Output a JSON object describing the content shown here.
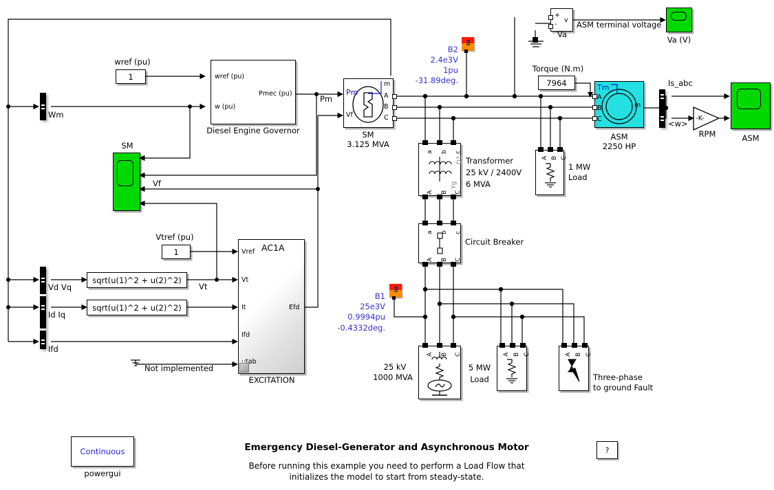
{
  "model": {
    "title": "Emergency Diesel-Generator and Asynchronous Motor",
    "subtitle_line1": "Before running this example you need to perform a Load Flow that",
    "subtitle_line2": "initializes the model to start from steady-state.",
    "help_label": "?"
  },
  "powergui": {
    "mode": "Continuous",
    "label": "powergui"
  },
  "constants": {
    "wref_caption": "wref (pu)",
    "wref_value": "1",
    "vtref_caption": "Vtref (pu)",
    "vtref_value": "1",
    "torque_caption": "Torque (N.m)",
    "torque_value": "7964"
  },
  "governor": {
    "name": "Diesel Engine Governor",
    "in1": "wref (pu)",
    "in2": "w (pu)",
    "out1": "Pmec (pu)"
  },
  "excitation": {
    "name": "EXCITATION",
    "type": "AC1A",
    "in1": "Vref",
    "in2": "Vt",
    "in3": "It",
    "in4": "Ifd",
    "in5": "··tab",
    "out1": "Efd",
    "ground_note": "Not implemented"
  },
  "fcn_blocks": [
    {
      "expr": "sqrt(u(1)^2 + u(2)^2)",
      "out_label": "Vt"
    },
    {
      "expr": "sqrt(u(1)^2 + u(2)^2)",
      "out_label": ""
    }
  ],
  "sm": {
    "name": "SM",
    "rating": "3.125 MVA",
    "in1": "Pm",
    "in2": "Vf",
    "out_m": "m",
    "out_a": "A",
    "out_b": "B",
    "out_c": "C",
    "pm_signal_label": "Pm",
    "scope_label": "SM",
    "vf_label": "Vf"
  },
  "asm": {
    "name": "ASM",
    "rating": "2250 HP",
    "in_tm": "Tm",
    "in_a": "A",
    "in_b": "B",
    "in_c": "C",
    "out_m": "m",
    "scope_label": "ASM",
    "is_label": "Is_abc",
    "w_label": "<w>",
    "gain_value": "-K-",
    "gain_label": "RPM"
  },
  "selectors": {
    "wm": "Wm",
    "vdvq": "Vd Vq",
    "idiq": "Id Iq",
    "ifd": "Ifd"
  },
  "measurements": [
    {
      "id": "B2",
      "icon": "m",
      "voltage": "2.4e3V",
      "pu": "1pu",
      "angle": "-31.89deg."
    },
    {
      "id": "B1",
      "icon": "m",
      "voltage": "25e3V",
      "pu": "0.9994pu",
      "angle": "-0.4332deg."
    }
  ],
  "va_sensor": {
    "name": "Va",
    "plus": "+",
    "minus": "-",
    "out": "v",
    "signal_label": "ASM terminal voltage",
    "scope_label": "Va (V)"
  },
  "transformer": {
    "line1": "Transformer",
    "line2": "25 kV / 2400V",
    "line3": "6 MVA",
    "top_ports": [
      "a",
      "b",
      "c"
    ],
    "bot_ports": [
      "A",
      "B",
      "C"
    ],
    "winding_top": "D1",
    "winding_bot": "Yg"
  },
  "breaker": {
    "name": "Circuit Breaker",
    "top_ports": [
      "a",
      "b",
      "c"
    ],
    "bot_ports": [
      "A",
      "B",
      "C"
    ]
  },
  "loads": [
    {
      "name_l1": "1 MW",
      "name_l2": "Load",
      "ports": [
        "A",
        "B",
        "C"
      ]
    },
    {
      "name_l1": "5 MW",
      "name_l2": "Load",
      "ports": [
        "A",
        "B",
        "C"
      ]
    }
  ],
  "source": {
    "line1": "25 kV",
    "line2": "1000 MVA",
    "ports": [
      "A",
      "B",
      "C"
    ]
  },
  "fault": {
    "line1": "Three-phase",
    "line2": "to ground Fault",
    "ports": [
      "A",
      "B",
      "C"
    ]
  },
  "colors": {
    "scope_green": "#00d900",
    "machine_cyan": "#25e0e0",
    "meas_red": "#ff1a00",
    "meas_orange": "#ff8c00",
    "annotation_blue": "#3333cc",
    "port_blue": "#1414c8",
    "wire": "#000000"
  }
}
